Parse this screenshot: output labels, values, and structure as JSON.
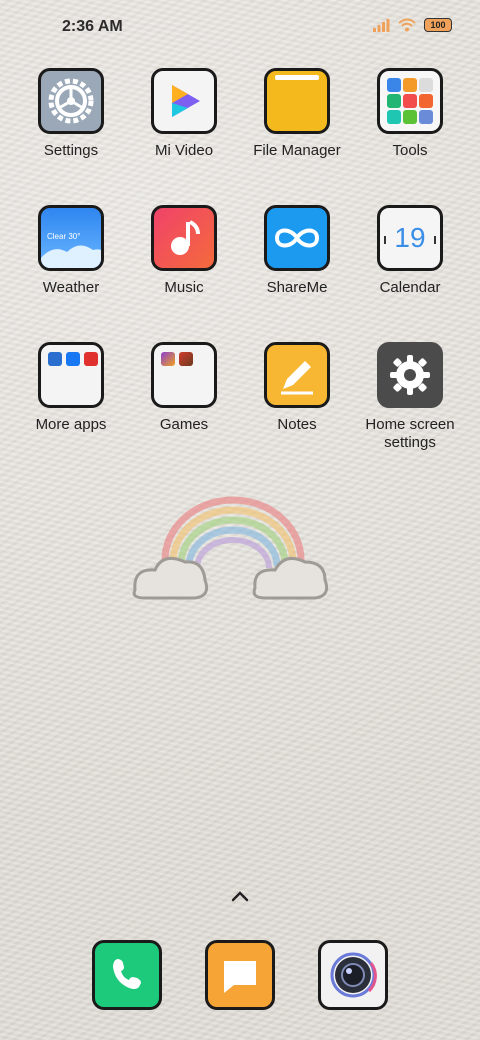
{
  "status_bar": {
    "time": "2:36 AM",
    "battery": "100"
  },
  "apps": [
    {
      "label": "Settings",
      "icon": "settings-icon"
    },
    {
      "label": "Mi Video",
      "icon": "mi-video-icon"
    },
    {
      "label": "File Manager",
      "icon": "file-manager-icon"
    },
    {
      "label": "Tools",
      "icon": "tools-folder-icon"
    },
    {
      "label": "Weather",
      "icon": "weather-icon",
      "icon_text": "Clear 30°"
    },
    {
      "label": "Music",
      "icon": "music-icon"
    },
    {
      "label": "ShareMe",
      "icon": "shareme-icon"
    },
    {
      "label": "Calendar",
      "icon": "calendar-icon",
      "icon_text": "19"
    },
    {
      "label": "More apps",
      "icon": "more-apps-folder-icon"
    },
    {
      "label": "Games",
      "icon": "games-folder-icon"
    },
    {
      "label": "Notes",
      "icon": "notes-icon"
    },
    {
      "label": "Home screen settings",
      "icon": "home-screen-settings-icon"
    }
  ],
  "dock": [
    {
      "name": "phone-icon",
      "color": "#1dc97a"
    },
    {
      "name": "messages-icon",
      "color": "#f7a437"
    },
    {
      "name": "camera-icon",
      "color": "#f2f2f2"
    }
  ],
  "colors": {
    "settings": "#9aa8b8",
    "file_manager": "#f3b91d",
    "weather": "#3b8ff0",
    "music": "#f04b5c",
    "shareme": "#1b9af0",
    "notes": "#f7b733",
    "home_settings": "#4b4b4b"
  }
}
